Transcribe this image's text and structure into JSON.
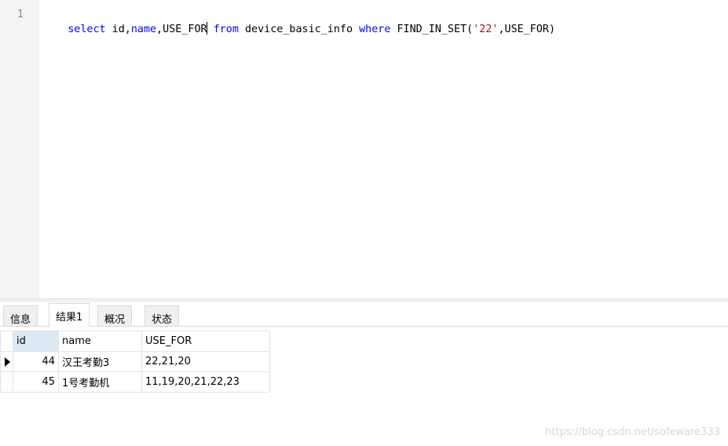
{
  "editor": {
    "line_number": "1",
    "tokens": [
      {
        "text": "select",
        "kind": "kw"
      },
      {
        "text": " id,",
        "kind": "plain"
      },
      {
        "text": "name",
        "kind": "kw"
      },
      {
        "text": ",USE_FOR",
        "kind": "plain"
      },
      {
        "text": " ",
        "kind": "plain"
      },
      {
        "text": "from",
        "kind": "kw"
      },
      {
        "text": " device_basic_info ",
        "kind": "plain"
      },
      {
        "text": "where",
        "kind": "kw"
      },
      {
        "text": " FIND_IN_SET(",
        "kind": "plain"
      },
      {
        "text": "'22'",
        "kind": "str"
      },
      {
        "text": ",USE_FOR)",
        "kind": "plain"
      }
    ]
  },
  "tabs": [
    {
      "label": "信息",
      "active": false
    },
    {
      "label": "结果1",
      "active": true
    },
    {
      "label": "概况",
      "active": false
    },
    {
      "label": "状态",
      "active": false
    }
  ],
  "result": {
    "columns": [
      "id",
      "name",
      "USE_FOR"
    ],
    "rows": [
      {
        "id": "44",
        "name": "汉王考勤3",
        "use_for": "22,21,20",
        "current": true
      },
      {
        "id": "45",
        "name": "1号考勤机",
        "use_for": "11,19,20,21,22,23",
        "current": false
      }
    ]
  },
  "watermark": "https://blog.csdn.net/sofeware333",
  "colors": {
    "keyword": "#0000ff",
    "string": "#a31515",
    "selected_header": "#dbe9f7"
  }
}
